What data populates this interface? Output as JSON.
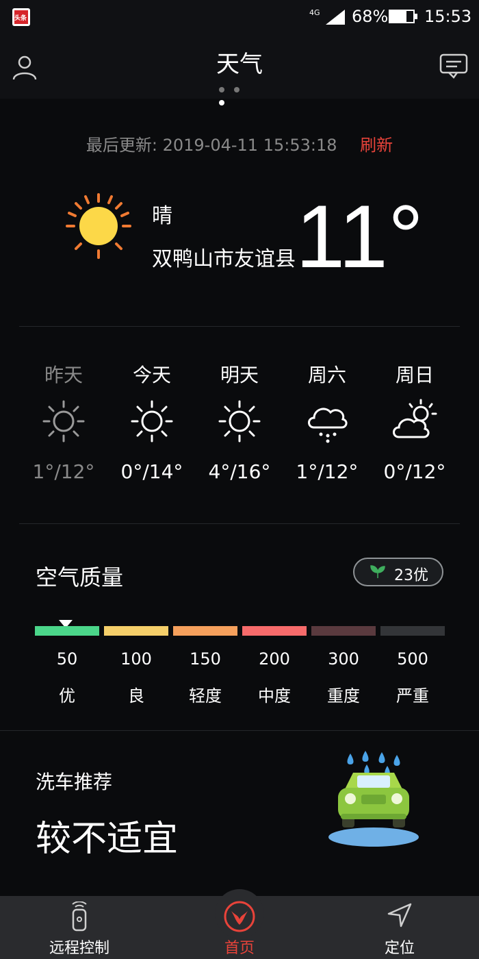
{
  "status_bar": {
    "app_badge": "头条",
    "network": "4G",
    "battery": "68%",
    "battery_level": 0.68,
    "time": "15:53"
  },
  "header": {
    "title": "天气",
    "page_dots": 3,
    "active_dot": 2
  },
  "update": {
    "label": "最后更新:",
    "timestamp": "2019-04-11 15:53:18",
    "refresh_label": "刷新"
  },
  "current": {
    "condition": "晴",
    "location": "双鸭山市友谊县",
    "temperature": "11°",
    "icon": "sun-icon"
  },
  "forecast": [
    {
      "day": "昨天",
      "temp": "1°/12°",
      "icon": "sunny-outline-icon",
      "dimmed": true
    },
    {
      "day": "今天",
      "temp": "0°/14°",
      "icon": "sunny-outline-icon",
      "dimmed": false
    },
    {
      "day": "明天",
      "temp": "4°/16°",
      "icon": "sunny-outline-icon",
      "dimmed": false
    },
    {
      "day": "周六",
      "temp": "1°/12°",
      "icon": "rain-cloud-icon",
      "dimmed": false
    },
    {
      "day": "周日",
      "temp": "0°/12°",
      "icon": "partly-cloudy-icon",
      "dimmed": false
    }
  ],
  "air_quality": {
    "title": "空气质量",
    "badge_value": "23优",
    "aqi": 23,
    "scale": [
      {
        "value": "50",
        "label": "优",
        "color": "#4bd68a"
      },
      {
        "value": "100",
        "label": "良",
        "color": "#f5cf6a"
      },
      {
        "value": "150",
        "label": "轻度",
        "color": "#f5a05c"
      },
      {
        "value": "200",
        "label": "中度",
        "color": "#f76b6b"
      },
      {
        "value": "300",
        "label": "重度",
        "color": "#5a3a3e"
      },
      {
        "value": "500",
        "label": "严重",
        "color": "#333538"
      }
    ]
  },
  "car_wash": {
    "title": "洗车推荐",
    "value": "较不适宜",
    "icon": "car-wash-icon"
  },
  "tabs": [
    {
      "label": "远程控制",
      "icon": "remote-control-icon",
      "active": false
    },
    {
      "label": "首页",
      "icon": "dongfeng-logo-icon",
      "active": true
    },
    {
      "label": "定位",
      "icon": "location-arrow-icon",
      "active": false
    }
  ],
  "colors": {
    "accent_red": "#e8433a",
    "background": "#0a0b0d",
    "header": "#101114",
    "tabbar": "#2a2b2e"
  }
}
